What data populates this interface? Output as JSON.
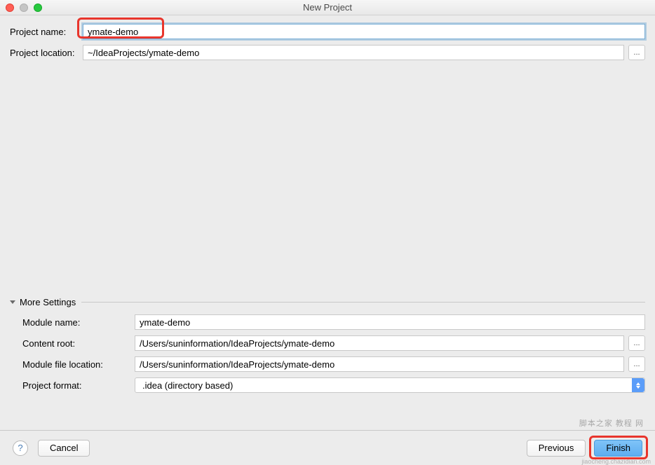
{
  "window": {
    "title": "New Project"
  },
  "form": {
    "projectName": {
      "label": "Project name:",
      "value": "ymate-demo"
    },
    "projectLocation": {
      "label": "Project location:",
      "value": "~/IdeaProjects/ymate-demo"
    }
  },
  "moreSettings": {
    "header": "More Settings",
    "moduleName": {
      "label": "Module name:",
      "value": "ymate-demo"
    },
    "contentRoot": {
      "label": "Content root:",
      "value": "/Users/suninformation/IdeaProjects/ymate-demo"
    },
    "moduleFileLocation": {
      "label": "Module file location:",
      "value": "/Users/suninformation/IdeaProjects/ymate-demo"
    },
    "projectFormat": {
      "label": "Project format:",
      "selected": ".idea (directory based)"
    }
  },
  "footer": {
    "help": "?",
    "cancel": "Cancel",
    "previous": "Previous",
    "finish": "Finish"
  },
  "browse": "...",
  "watermark": "脚本之家 教程 网",
  "watermarkSub": "jiaocheng.chazidian.com"
}
